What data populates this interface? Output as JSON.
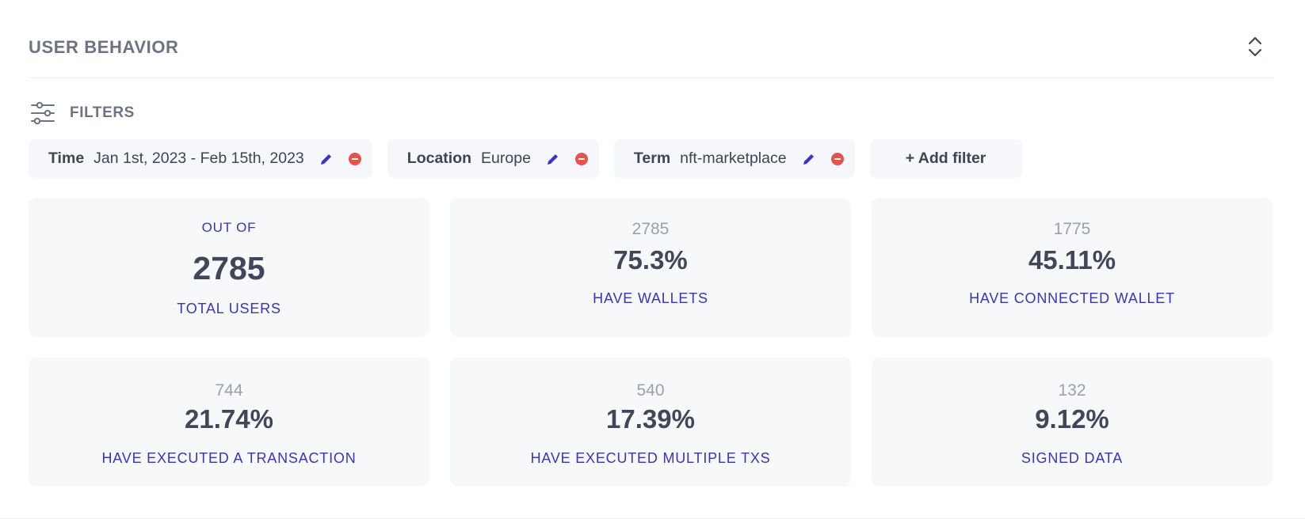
{
  "section": {
    "title": "USER BEHAVIOR",
    "toggle_icon": "expand-collapse-chevrons-icon"
  },
  "filters": {
    "label": "FILTERS",
    "icon": "sliders-icon",
    "chips": [
      {
        "key": "Time",
        "value": "Jan 1st, 2023 - Feb 15th, 2023"
      },
      {
        "key": "Location",
        "value": "Europe"
      },
      {
        "key": "Term",
        "value": "nft-marketplace"
      }
    ],
    "add_label": "+ Add filter"
  },
  "metrics": {
    "total": {
      "caption": "OUT OF",
      "value": "2785",
      "label": "TOTAL USERS"
    },
    "cards": [
      {
        "count": "2785",
        "percent": "75.3%",
        "label": "HAVE WALLETS"
      },
      {
        "count": "1775",
        "percent": "45.11%",
        "label": "HAVE CONNECTED WALLET"
      },
      {
        "count": "744",
        "percent": "21.74%",
        "label": "HAVE EXECUTED A TRANSACTION"
      },
      {
        "count": "540",
        "percent": "17.39%",
        "label": "HAVE EXECUTED MULTIPLE TXS"
      },
      {
        "count": "132",
        "percent": "9.12%",
        "label": "SIGNED DATA"
      }
    ]
  },
  "colors": {
    "accent": "#3b35b6",
    "edit_icon": "#3a33c7",
    "remove_icon": "#e5534b",
    "card_bg": "#f7f8fa",
    "muted_text": "#9aa0ad",
    "heading_text": "#6c7385"
  }
}
